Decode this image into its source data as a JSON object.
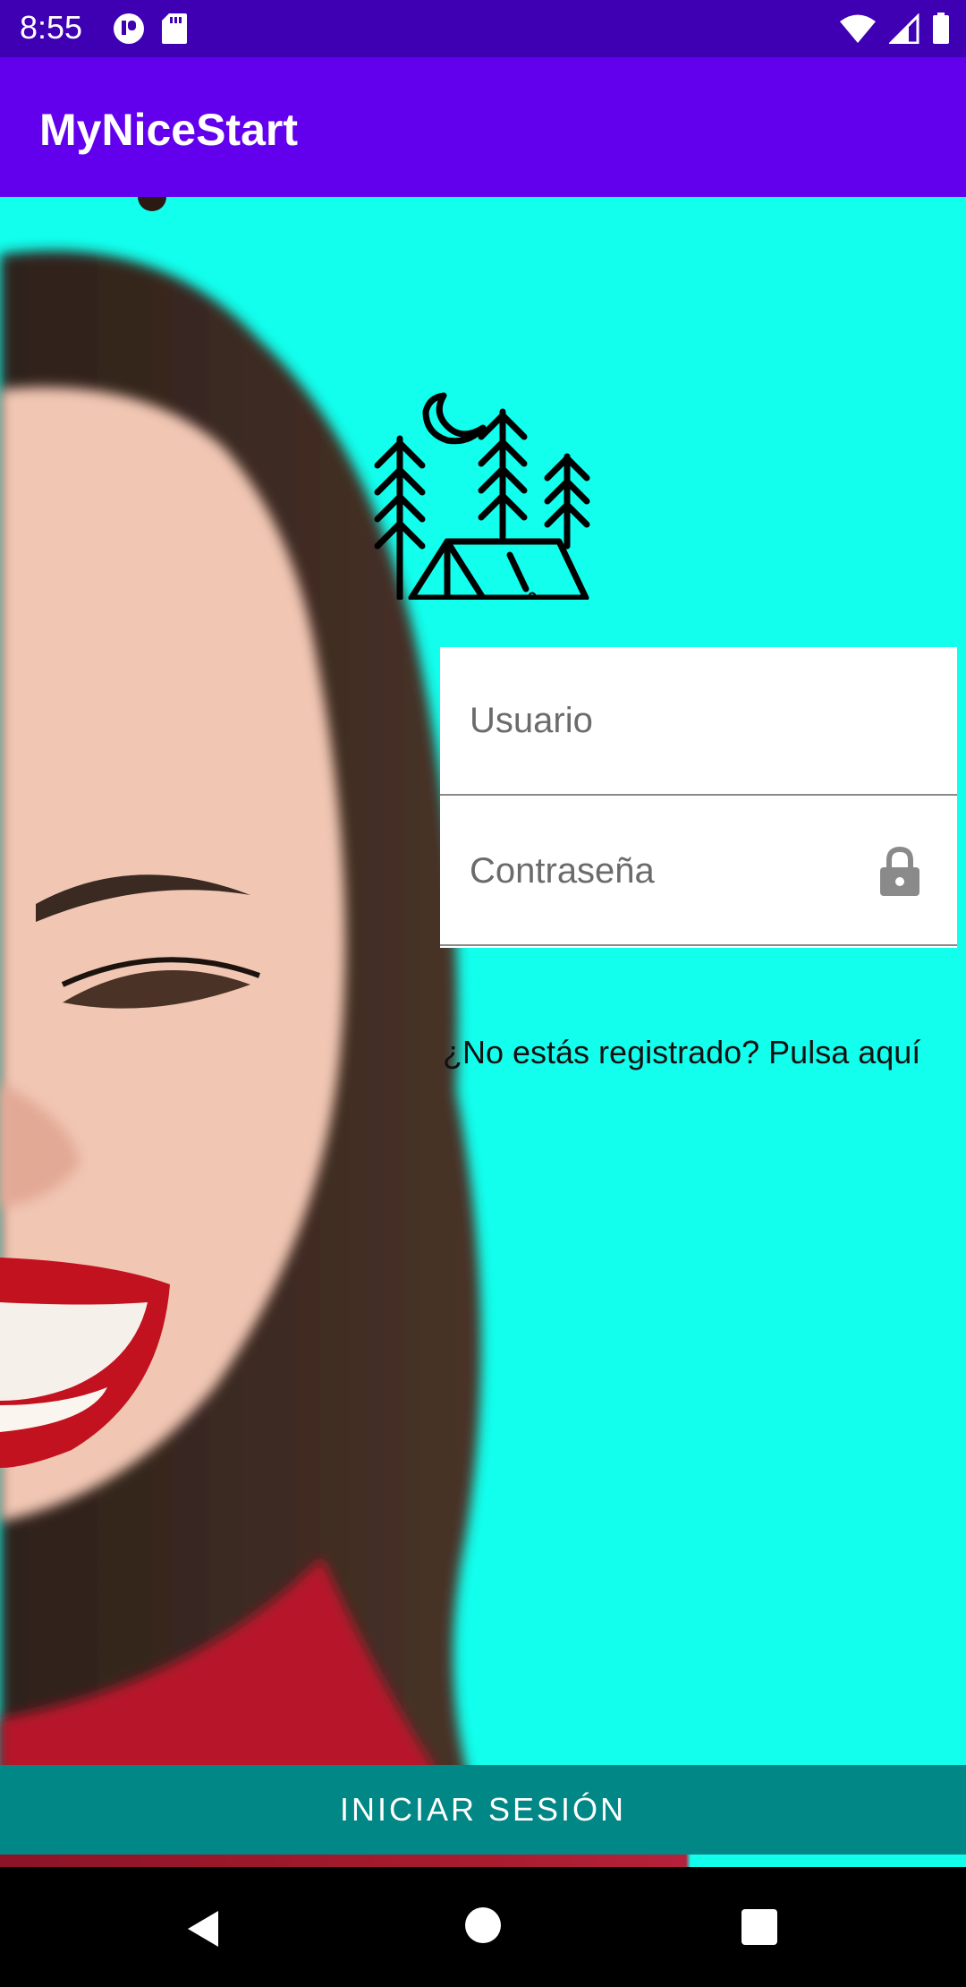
{
  "status_bar": {
    "time": "8:55",
    "left_icons": [
      "cast-icon",
      "sd-card-icon"
    ],
    "right_icons": [
      "wifi-icon",
      "signal-icon",
      "battery-icon"
    ]
  },
  "app_bar": {
    "title": "MyNiceStart"
  },
  "logo": {
    "icon": "camping-tent-icon"
  },
  "form": {
    "username": {
      "value": "",
      "placeholder": "Usuario"
    },
    "password": {
      "value": "",
      "placeholder": "Contraseña",
      "icon": "lock-icon"
    }
  },
  "register_link": "¿No estás registrado? Pulsa aquí",
  "login_button": "INICIAR SESIÓN",
  "nav_bar": {
    "icons": [
      "back-icon",
      "home-icon",
      "recents-icon"
    ]
  },
  "colors": {
    "status_bar": "#3f00b3",
    "app_bar": "#6200ee",
    "background": "#12ffee",
    "button": "#018786"
  }
}
